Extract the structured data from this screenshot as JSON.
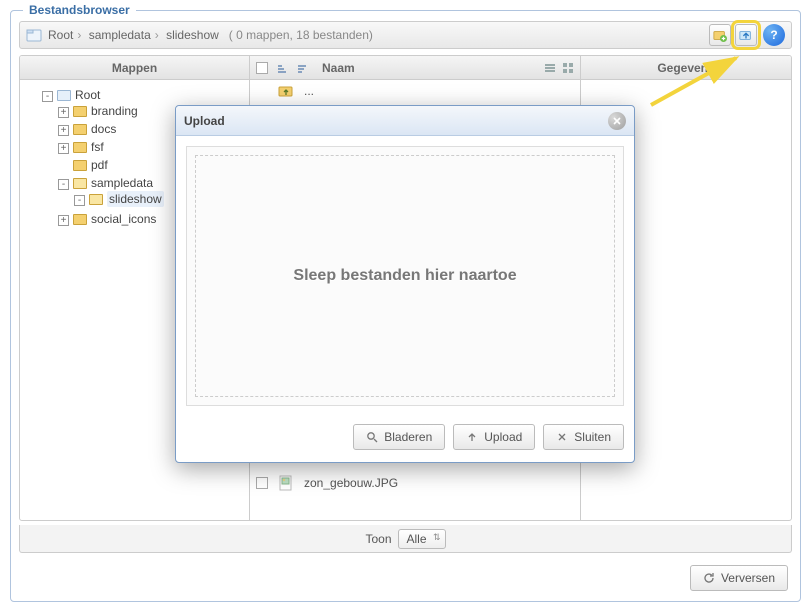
{
  "panel": {
    "title": "Bestandsbrowser"
  },
  "toolbar": {
    "crumbs": [
      "Root",
      "sampledata",
      "slideshow"
    ],
    "stats": "( 0 mappen, 18 bestanden)"
  },
  "columns": {
    "folders_header": "Mappen",
    "files_header": "Naam",
    "data_header": "Gegevens"
  },
  "tree": {
    "root": "Root",
    "items": [
      {
        "label": "branding",
        "toggle": "+"
      },
      {
        "label": "docs",
        "toggle": "+"
      },
      {
        "label": "fsf",
        "toggle": "+"
      },
      {
        "label": "pdf",
        "toggle": ""
      },
      {
        "label": "sampledata",
        "toggle": "-",
        "children": [
          {
            "label": "slideshow",
            "toggle": "-",
            "selected": true
          }
        ]
      },
      {
        "label": "social_icons",
        "toggle": "+"
      }
    ]
  },
  "files": {
    "up_row": "...",
    "visible_row": "zon_gebouw.JPG"
  },
  "pager": {
    "label": "Toon",
    "value": "Alle"
  },
  "refresh": {
    "label": "Verversen"
  },
  "modal": {
    "title": "Upload",
    "dropzone": "Sleep bestanden hier naartoe",
    "browse": "Bladeren",
    "upload": "Upload",
    "close": "Sluiten"
  }
}
